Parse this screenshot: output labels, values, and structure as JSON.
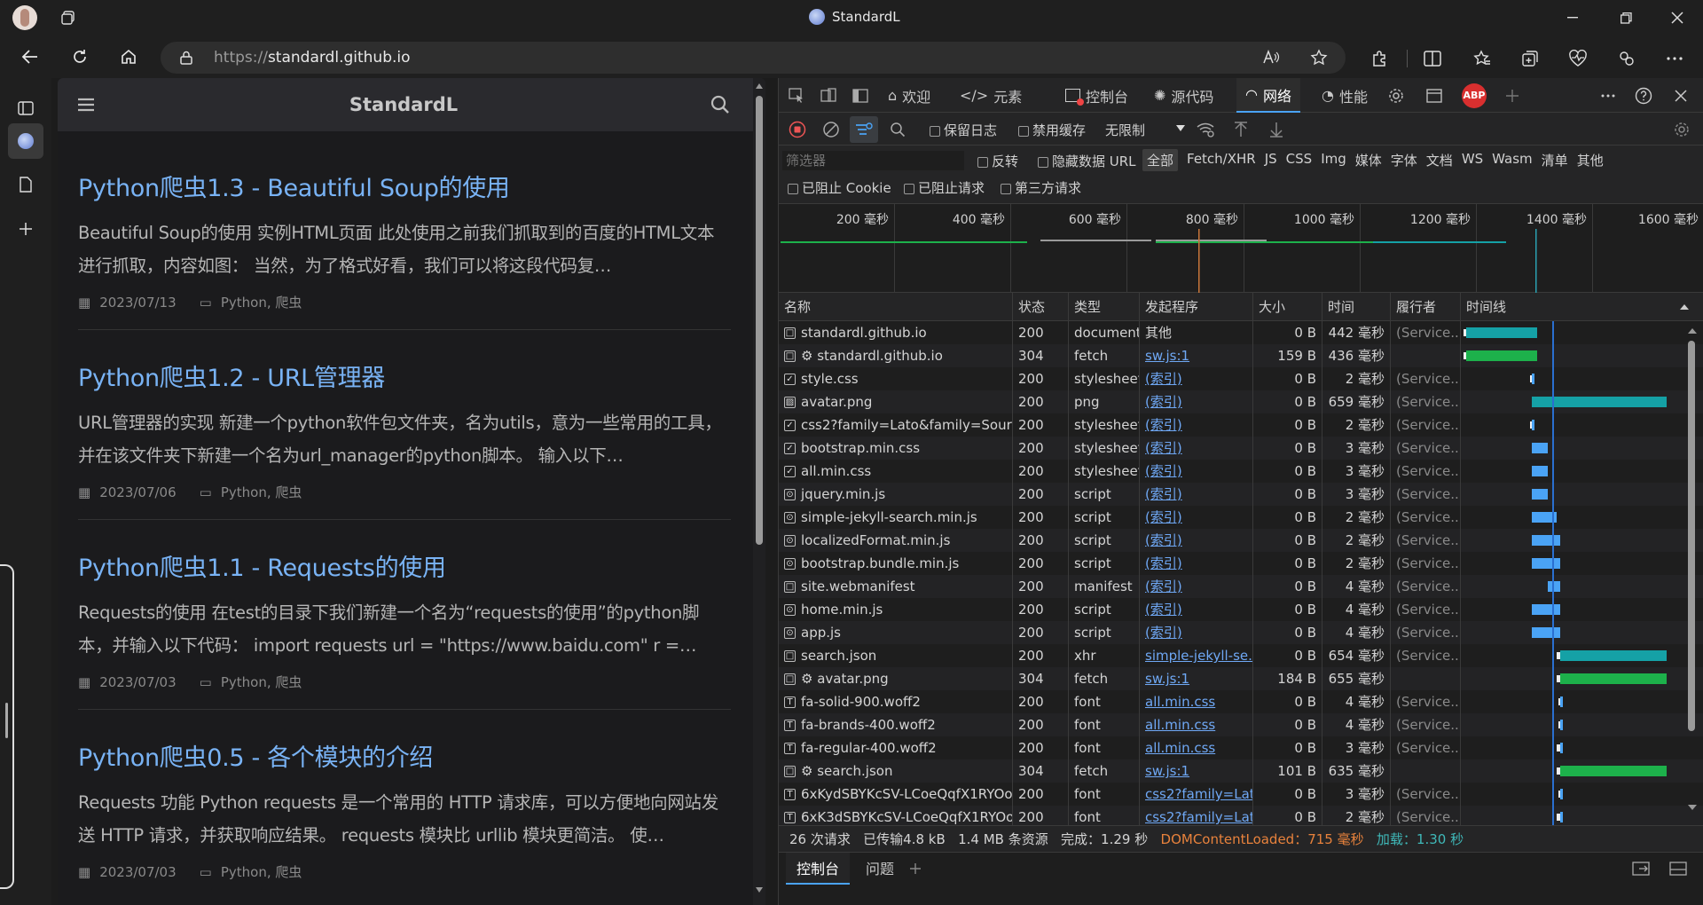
{
  "browser": {
    "tab_title": "StandardL",
    "url_prefix": "https://",
    "url_host": "standardl.github.io"
  },
  "blog": {
    "site_title": "StandardL",
    "posts": [
      {
        "title": "Python爬虫1.3 - Beautiful Soup的使用",
        "excerpt": "Beautiful Soup的使用 实例HTML页面 此处使用之前我们抓取到的百度的HTML文本进行抓取，内容如图： 当然，为了格式好看，我们可以将这段代码复…",
        "date": "2023/07/13",
        "tags": "Python, 爬虫"
      },
      {
        "title": "Python爬虫1.2 - URL管理器",
        "excerpt": "URL管理器的实现 新建一个python软件包文件夹，名为utils，意为一些常用的工具，并在该文件夹下新建一个名为url_manager的python脚本。 输入以下…",
        "date": "2023/07/06",
        "tags": "Python, 爬虫"
      },
      {
        "title": "Python爬虫1.1 - Requests的使用",
        "excerpt": "Requests的使用 在test的目录下我们新建一个名为“requests的使用”的python脚本，并输入以下代码： import requests url = \"https://www.baidu.com\" r =…",
        "date": "2023/07/03",
        "tags": "Python, 爬虫"
      },
      {
        "title": "Python爬虫0.5 - 各个模块的介绍",
        "excerpt": "Requests 功能 Python requests 是一个常用的 HTTP 请求库，可以方便地向网站发送 HTTP 请求，并获取响应结果。 requests 模块比 urllib 模块更简洁。 使…",
        "date": "2023/07/03",
        "tags": "Python, 爬虫"
      }
    ]
  },
  "devtools": {
    "tabs": [
      "欢迎",
      "元素",
      "控制台",
      "源代码",
      "网络",
      "性能"
    ],
    "active_tab": "网络",
    "abp": "ABP",
    "toolbar": {
      "preserve_log": "保留日志",
      "disable_cache": "禁用缓存",
      "throttle": "无限制"
    },
    "filter": {
      "placeholder": "筛选器",
      "invert": "反转",
      "hide_data_url": "隐藏数据 URL",
      "types": [
        "全部",
        "Fetch/XHR",
        "JS",
        "CSS",
        "Img",
        "媒体",
        "字体",
        "文档",
        "WS",
        "Wasm",
        "清单",
        "其他"
      ],
      "blocked_cookies": "已阻止 Cookie",
      "blocked_requests": "已阻止请求",
      "third_party": "第三方请求"
    },
    "overview_ticks": [
      "200 毫秒",
      "400 毫秒",
      "600 毫秒",
      "800 毫秒",
      "1000 毫秒",
      "1200 毫秒",
      "1400 毫秒",
      "1600 毫秒"
    ],
    "columns": [
      "名称",
      "状态",
      "类型",
      "发起程序",
      "大小",
      "时间",
      "履行者",
      "时间线"
    ],
    "rows": [
      {
        "name": "standardl.github.io",
        "status": "200",
        "type": "document",
        "initiator": "其他",
        "init_link": false,
        "size": "0 B",
        "time": "442 毫秒",
        "fulfilled": "(Service..."
      },
      {
        "name": "⚙ standardl.github.io",
        "status": "304",
        "type": "fetch",
        "initiator": "sw.js:1",
        "init_link": true,
        "size": "159 B",
        "time": "436 毫秒",
        "fulfilled": ""
      },
      {
        "name": "style.css",
        "status": "200",
        "type": "stylesheet",
        "initiator": "(索引)",
        "init_link": true,
        "size": "0 B",
        "time": "2 毫秒",
        "fulfilled": "(Service..."
      },
      {
        "name": "avatar.png",
        "status": "200",
        "type": "png",
        "initiator": "(索引)",
        "init_link": true,
        "size": "0 B",
        "time": "659 毫秒",
        "fulfilled": "(Service..."
      },
      {
        "name": "css2?family=Lato&family=Sourc...",
        "status": "200",
        "type": "stylesheet",
        "initiator": "(索引)",
        "init_link": true,
        "size": "0 B",
        "time": "2 毫秒",
        "fulfilled": "(Service..."
      },
      {
        "name": "bootstrap.min.css",
        "status": "200",
        "type": "stylesheet",
        "initiator": "(索引)",
        "init_link": true,
        "size": "0 B",
        "time": "3 毫秒",
        "fulfilled": "(Service..."
      },
      {
        "name": "all.min.css",
        "status": "200",
        "type": "stylesheet",
        "initiator": "(索引)",
        "init_link": true,
        "size": "0 B",
        "time": "3 毫秒",
        "fulfilled": "(Service..."
      },
      {
        "name": "jquery.min.js",
        "status": "200",
        "type": "script",
        "initiator": "(索引)",
        "init_link": true,
        "size": "0 B",
        "time": "3 毫秒",
        "fulfilled": "(Service..."
      },
      {
        "name": "simple-jekyll-search.min.js",
        "status": "200",
        "type": "script",
        "initiator": "(索引)",
        "init_link": true,
        "size": "0 B",
        "time": "2 毫秒",
        "fulfilled": "(Service..."
      },
      {
        "name": "localizedFormat.min.js",
        "status": "200",
        "type": "script",
        "initiator": "(索引)",
        "init_link": true,
        "size": "0 B",
        "time": "2 毫秒",
        "fulfilled": "(Service..."
      },
      {
        "name": "bootstrap.bundle.min.js",
        "status": "200",
        "type": "script",
        "initiator": "(索引)",
        "init_link": true,
        "size": "0 B",
        "time": "2 毫秒",
        "fulfilled": "(Service..."
      },
      {
        "name": "site.webmanifest",
        "status": "200",
        "type": "manifest",
        "initiator": "(索引)",
        "init_link": true,
        "size": "0 B",
        "time": "4 毫秒",
        "fulfilled": "(Service..."
      },
      {
        "name": "home.min.js",
        "status": "200",
        "type": "script",
        "initiator": "(索引)",
        "init_link": true,
        "size": "0 B",
        "time": "4 毫秒",
        "fulfilled": "(Service..."
      },
      {
        "name": "app.js",
        "status": "200",
        "type": "script",
        "initiator": "(索引)",
        "init_link": true,
        "size": "0 B",
        "time": "4 毫秒",
        "fulfilled": "(Service..."
      },
      {
        "name": "search.json",
        "status": "200",
        "type": "xhr",
        "initiator": "simple-jekyll-se...",
        "init_link": true,
        "size": "0 B",
        "time": "654 毫秒",
        "fulfilled": "(Service..."
      },
      {
        "name": "⚙ avatar.png",
        "status": "304",
        "type": "fetch",
        "initiator": "sw.js:1",
        "init_link": true,
        "size": "184 B",
        "time": "655 毫秒",
        "fulfilled": ""
      },
      {
        "name": "fa-solid-900.woff2",
        "status": "200",
        "type": "font",
        "initiator": "all.min.css",
        "init_link": true,
        "size": "0 B",
        "time": "4 毫秒",
        "fulfilled": "(Service..."
      },
      {
        "name": "fa-brands-400.woff2",
        "status": "200",
        "type": "font",
        "initiator": "all.min.css",
        "init_link": true,
        "size": "0 B",
        "time": "4 毫秒",
        "fulfilled": "(Service..."
      },
      {
        "name": "fa-regular-400.woff2",
        "status": "200",
        "type": "font",
        "initiator": "all.min.css",
        "init_link": true,
        "size": "0 B",
        "time": "3 毫秒",
        "fulfilled": "(Service..."
      },
      {
        "name": "⚙ search.json",
        "status": "304",
        "type": "fetch",
        "initiator": "sw.js:1",
        "init_link": true,
        "size": "101 B",
        "time": "635 毫秒",
        "fulfilled": ""
      },
      {
        "name": "6xKydSBYKcSV-LCoeQqfX1RYOo...",
        "status": "200",
        "type": "font",
        "initiator": "css2?family=Lat...",
        "init_link": true,
        "size": "0 B",
        "time": "3 毫秒",
        "fulfilled": "(Service..."
      },
      {
        "name": "6xK3dSBYKcSV-LCoeQqfX1RYOo...",
        "status": "200",
        "type": "font",
        "initiator": "css2?family=Lat...",
        "init_link": true,
        "size": "0 B",
        "time": "2 毫秒",
        "fulfilled": "(Service..."
      }
    ],
    "status_bar": {
      "requests": "26 次请求",
      "transferred": "已传输4.8 kB",
      "resources": "1.4 MB 条资源",
      "finish": "完成：1.29 秒",
      "dcl": "DOMContentLoaded：715 毫秒",
      "load": "加载：1.30 秒"
    },
    "drawer": {
      "console": "控制台",
      "issues": "问题"
    }
  },
  "colors": {
    "accent": "#4aa3f5",
    "link": "#79b3f5",
    "dcl": "#e8823c",
    "load": "#3fb8b8",
    "teal": "#15a1a6",
    "green": "#1db14b"
  }
}
